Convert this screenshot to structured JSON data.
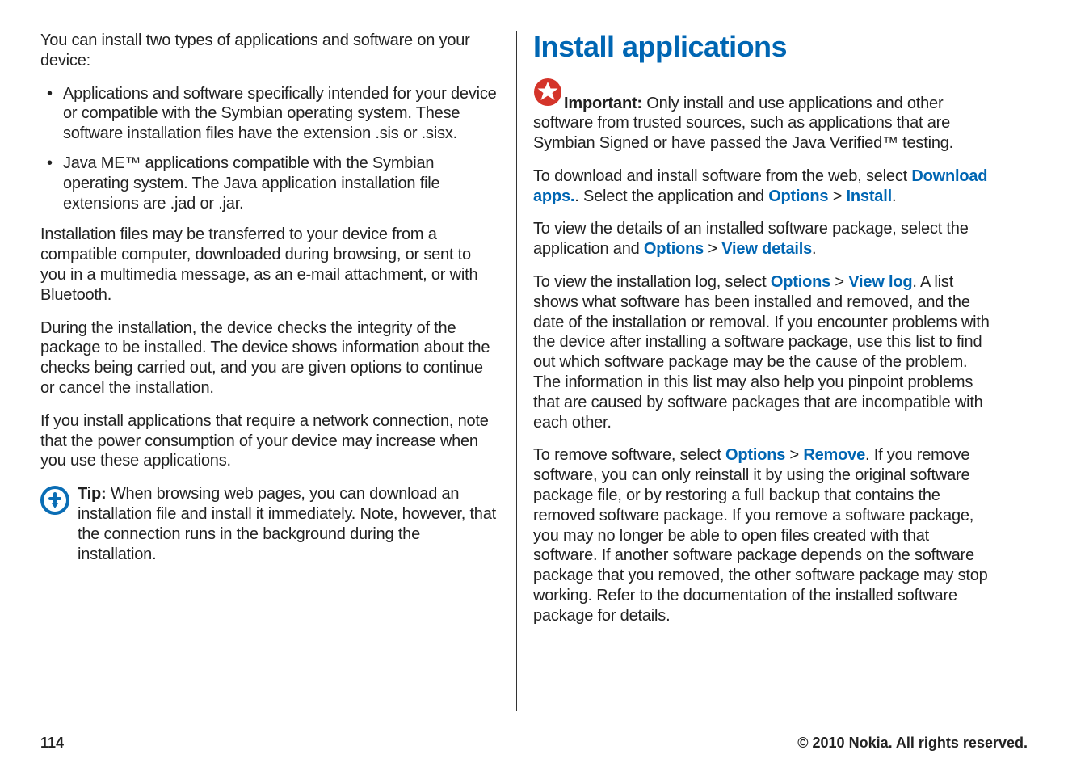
{
  "left": {
    "intro": "You can install two types of applications and software on your device:",
    "bullets": [
      "Applications and software specifically intended for your device or compatible with the Symbian operating system. These software installation files have the extension .sis or .sisx.",
      "Java ME™ applications compatible with the Symbian operating system. The Java application installation file extensions are .jad or .jar."
    ],
    "para1": "Installation files may be transferred to your device from a compatible computer, downloaded during browsing, or sent to you in a multimedia message, as an e-mail attachment, or with Bluetooth.",
    "para2": "During the installation, the device checks the integrity of the package to be installed. The device shows information about the checks being carried out, and you are given options to continue or cancel the installation.",
    "para3": "If you install applications that require a network connection, note that the power consumption of your device may increase when you use these applications.",
    "tip_label": "Tip:",
    "tip_text": " When browsing web pages, you can download an installation file and install it immediately. Note, however, that the connection runs in the background during the installation."
  },
  "right": {
    "heading": "Install applications",
    "important_label": "Important:",
    "important_text": "  Only install and use applications and other software from trusted sources, such as applications that are Symbian Signed or have passed the Java Verified™ testing.",
    "para1_a": "To download and install software from the web, select ",
    "para1_link1": "Download apps.",
    "para1_b": ". Select the application and ",
    "para1_link2": "Options",
    "para1_c": " > ",
    "para1_link3": "Install",
    "para1_d": ".",
    "para2_a": "To view the details of an installed software package, select the application and ",
    "para2_link1": "Options",
    "para2_b": " > ",
    "para2_link2": "View details",
    "para2_c": ".",
    "para3_a": "To view the installation log, select ",
    "para3_link1": "Options",
    "para3_b": " > ",
    "para3_link2": "View log",
    "para3_c": ". A list shows what software has been installed and removed, and the date of the installation or removal. If you encounter problems with the device after installing a software package, use this list to find out which software package may be the cause of the problem. The information in this list may also help you pinpoint problems that are caused by software packages that are incompatible with each other.",
    "para4_a": "To remove software, select ",
    "para4_link1": "Options",
    "para4_b": " > ",
    "para4_link2": "Remove",
    "para4_c": ". If you remove software, you can only reinstall it by using the original software package file, or by restoring a full backup that contains the removed software package. If you remove a software package, you may no longer be able to open files created with that software. If another software package depends on the software package that you removed, the other software package may stop working. Refer to the documentation of the installed software package for details."
  },
  "footer": {
    "page": "114",
    "copyright": "© 2010 Nokia. All rights reserved."
  }
}
